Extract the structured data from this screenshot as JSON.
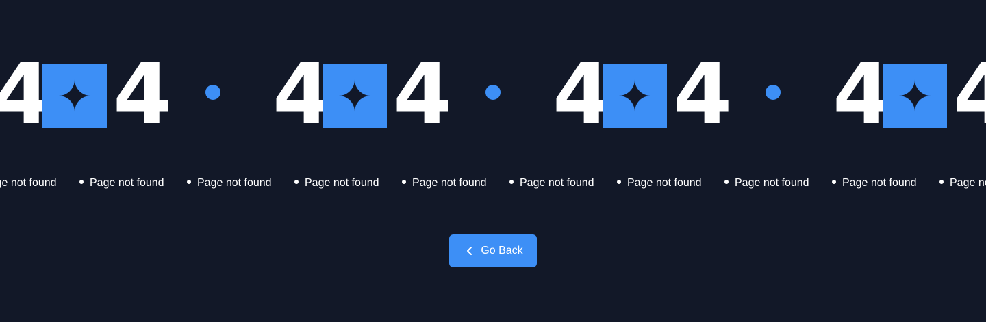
{
  "hero": {
    "code_left": "4",
    "code_right": "4",
    "accent_color": "#3d8ff6",
    "zero_icon": "petal-cluster-icon",
    "separator_icon": "dot-icon"
  },
  "tagline": {
    "text": "Page not found",
    "bullet_icon": "bullet-icon"
  },
  "actions": {
    "go_back_label": "Go Back",
    "go_back_icon": "chevron-left-icon"
  },
  "colors": {
    "background": "#121828",
    "text": "#ffffff",
    "accent": "#3d8ff6"
  }
}
